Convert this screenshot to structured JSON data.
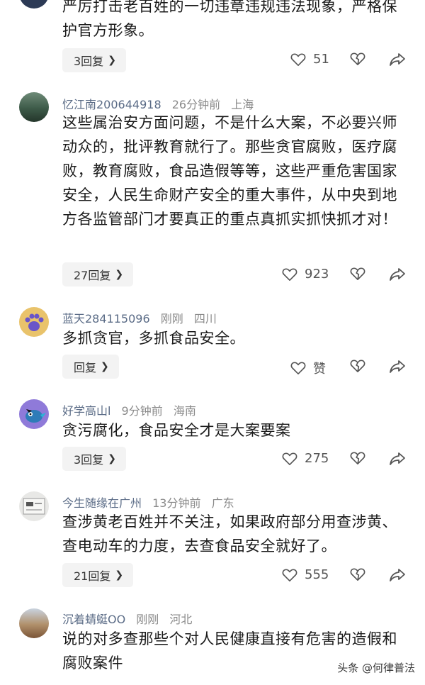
{
  "comments": [
    {
      "text": "严厉打击老百姓的一切违章违规违法现象，严格保护官方形象。",
      "reply_label": "3回复",
      "likes": "51"
    },
    {
      "username": "忆江南200644918",
      "time": "26分钟前",
      "location": "上海",
      "text": "这些属治安方面问题，不是什么大案，不必要兴师动众的，批评教育就行了。那些贪官腐败，医疗腐败，教育腐败，食品造假等等，这些严重危害国家安全，人民生命财产安全的重大事件，从中央到地方各监管部门才要真正的重点真抓实抓快抓才对！",
      "reply_label": "27回复",
      "likes": "923"
    },
    {
      "username": "蓝天284115096",
      "time": "刚刚",
      "location": "四川",
      "text": "多抓贪官，多抓食品安全。",
      "reply_label": "回复",
      "likes": "赞"
    },
    {
      "username": "好学高山l",
      "time": "9分钟前",
      "location": "海南",
      "text": "贪污腐化，食品安全才是大案要案",
      "reply_label": "3回复",
      "likes": "275"
    },
    {
      "username": "今生随缘在广州",
      "time": "13分钟前",
      "location": "广东",
      "text": "查涉黄老百姓并不关注，如果政府部分用查涉黄、查电动车的力度，去查食品安全就好了。",
      "reply_label": "21回复",
      "likes": "555"
    },
    {
      "username": "沉着蜻蜓OO",
      "time": "刚刚",
      "location": "河北",
      "text": "说的对多查那些个对人民健康直接有危害的造假和腐败案件"
    }
  ],
  "watermark": "头条 @何律普法",
  "icons": {
    "like": "heart-outline-icon",
    "dislike": "broken-heart-icon",
    "share": "share-arrow-icon",
    "chevron": "chevron-right-icon"
  }
}
